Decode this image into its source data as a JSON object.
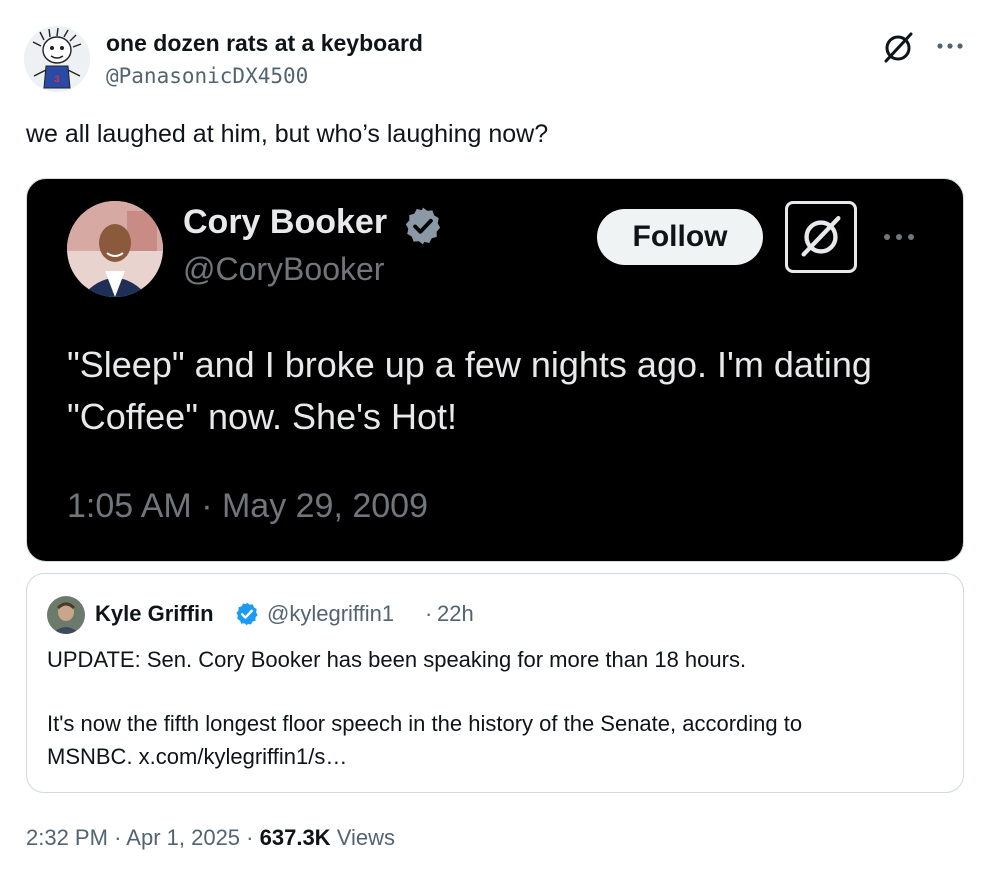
{
  "post": {
    "author_name": "one dozen rats at a keyboard",
    "author_handle": "@PanasonicDX4500",
    "text": "we all laughed at him, but who’s laughing now?",
    "time": "2:32 PM",
    "date": "Apr 1, 2025",
    "separator": "·",
    "views_count": "637.3K",
    "views_label": "Views"
  },
  "embedded_screenshot": {
    "name": "Cory Booker",
    "handle": "@CoryBooker",
    "follow_label": "Follow",
    "text": "\"Sleep\" and I broke up a few nights ago. I'm dating \"Coffee\" now. She's Hot!",
    "timestamp": "1:05 AM · May 29, 2009",
    "verified_icon": "verified-badge-icon"
  },
  "quoted": {
    "name": "Kyle Griffin",
    "handle": "@kylegriffin1",
    "separator": "·",
    "time": "22h",
    "line1": "UPDATE: Sen. Cory Booker has been speaking for more than 18 hours.",
    "line2": "It's now the fifth longest floor speech in the history of the Senate, according to",
    "line3": "MSNBC. x.com/kylegriffin1/s…"
  },
  "colors": {
    "verified_blue": "#1d9bf0",
    "muted_text": "#536471",
    "dark_bg": "#000000"
  }
}
